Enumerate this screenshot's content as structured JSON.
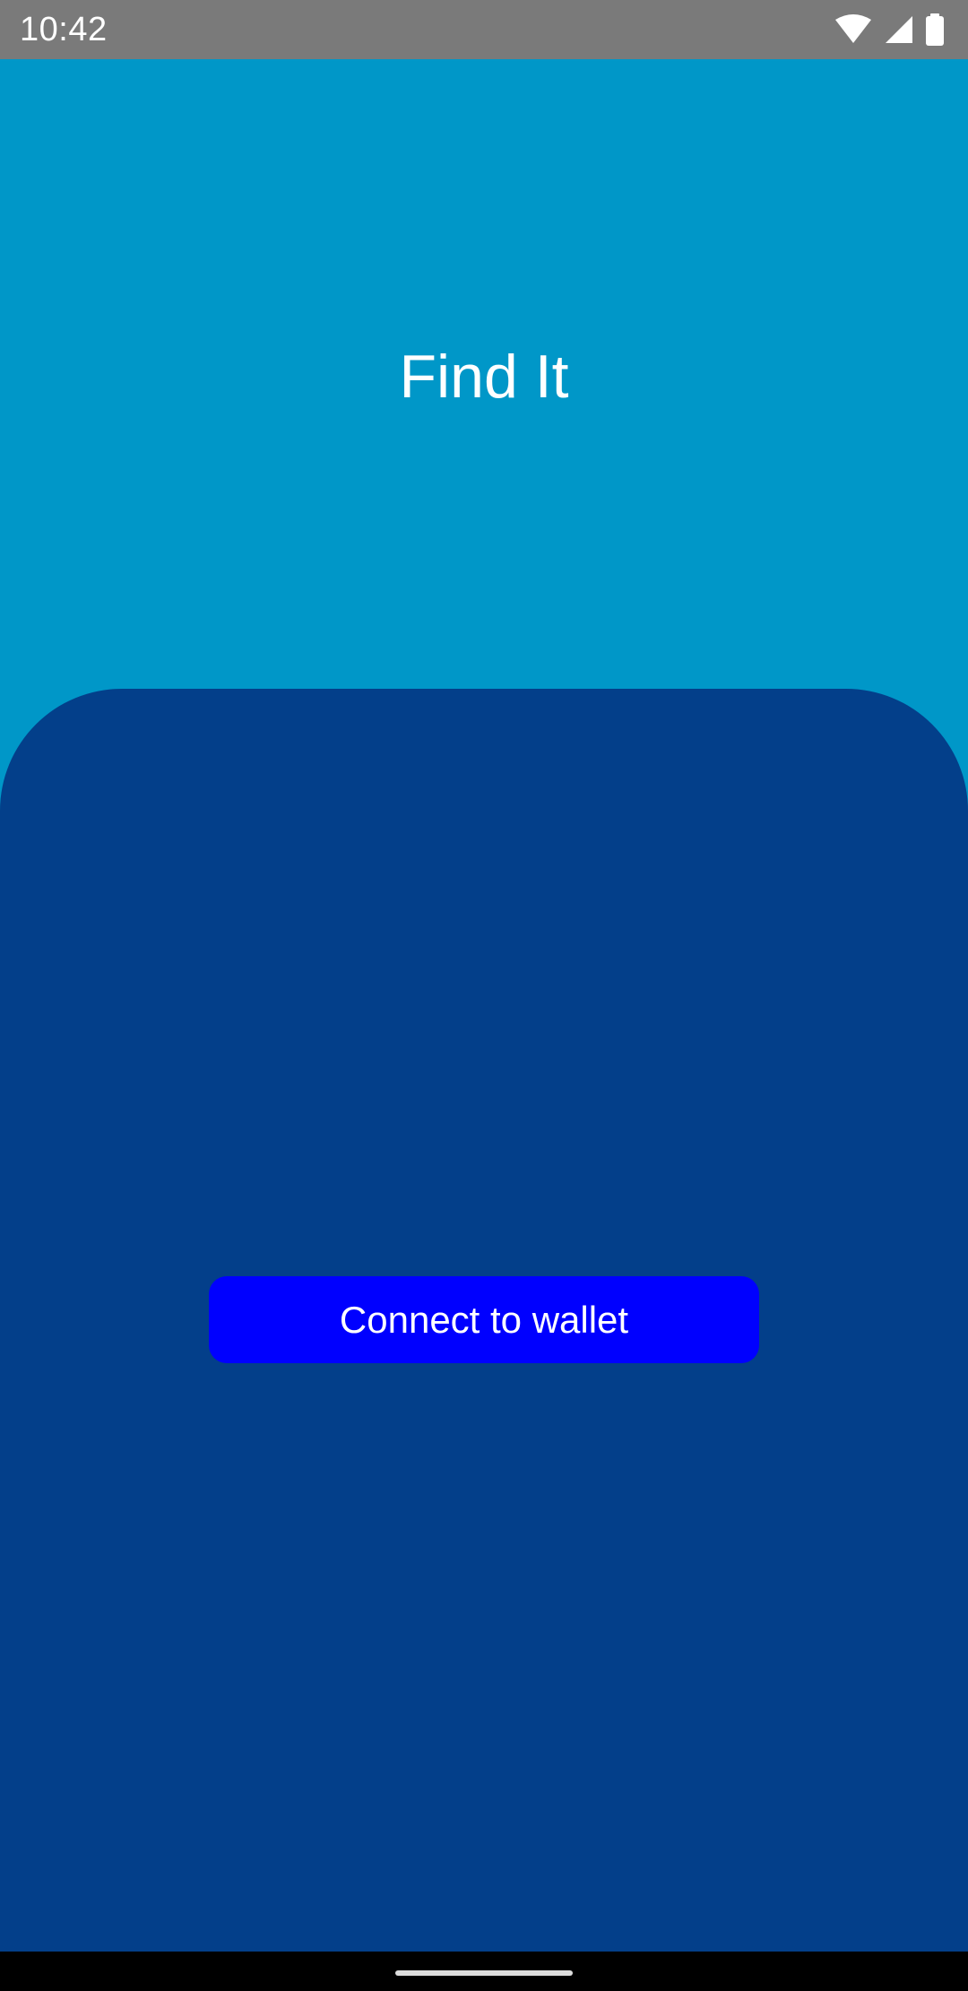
{
  "status_bar": {
    "time": "10:42",
    "icons": [
      "wifi-icon",
      "signal-icon",
      "battery-icon"
    ]
  },
  "app": {
    "title": "Find It"
  },
  "actions": {
    "connect_label": "Connect to wallet"
  },
  "colors": {
    "status_bar": "#7a7a7a",
    "header_background": "#0097c8",
    "panel_background": "#033f8a",
    "button_background": "#0000ff",
    "text": "#ffffff"
  }
}
